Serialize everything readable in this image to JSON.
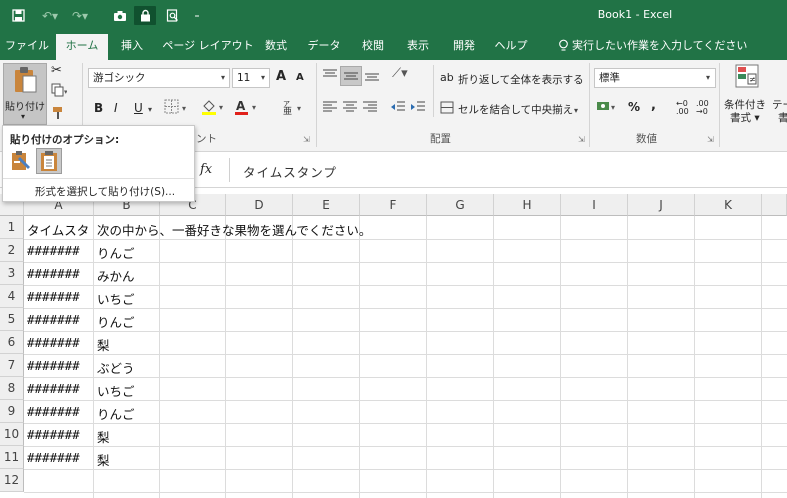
{
  "window": {
    "title": "Book1  -  Excel"
  },
  "tabs": [
    "ファイル",
    "ホーム",
    "挿入",
    "ページ レイアウト",
    "数式",
    "データ",
    "校閲",
    "表示",
    "開発",
    "ヘルプ"
  ],
  "tell_me": "実行したい作業を入力してください",
  "ribbon": {
    "paste_label": "貼り付け",
    "font_name": "游ゴシック",
    "font_size": "11",
    "grow_font": "A",
    "shrink_font": "A",
    "bold": "B",
    "italic": "I",
    "underline": "U",
    "wrap_text": "折り返して全体を表示する",
    "merge_center": "セルを結合して中央揃え",
    "number_format": "標準",
    "percent": "%",
    "comma": ",",
    "conditional_format_line1": "条件付き",
    "conditional_format_line2": "書式 ▾",
    "table_format_partial": "テー",
    "table_format_partial2": "書",
    "group_font_partial": "ント",
    "group_alignment": "配置",
    "group_number": "数値"
  },
  "paste_options": {
    "title": "貼り付けのオプション:",
    "paste_special": "形式を選択して貼り付け(S)..."
  },
  "formula_bar": {
    "fx": "fx",
    "value": "タイムスタンプ"
  },
  "columns": [
    "A",
    "B",
    "C",
    "D",
    "E",
    "F",
    "G",
    "H",
    "I",
    "J",
    "K"
  ],
  "rows": [
    {
      "num": "1",
      "a": "タイムスタ",
      "b": "次の中から、一番好きな果物を選んでください。"
    },
    {
      "num": "2",
      "a": "#######",
      "b": "りんご"
    },
    {
      "num": "3",
      "a": "#######",
      "b": "みかん"
    },
    {
      "num": "4",
      "a": "#######",
      "b": "いちご"
    },
    {
      "num": "5",
      "a": "#######",
      "b": "りんご"
    },
    {
      "num": "6",
      "a": "#######",
      "b": "梨"
    },
    {
      "num": "7",
      "a": "#######",
      "b": "ぶどう"
    },
    {
      "num": "8",
      "a": "#######",
      "b": "いちご"
    },
    {
      "num": "9",
      "a": "#######",
      "b": "りんご"
    },
    {
      "num": "10",
      "a": "#######",
      "b": "梨"
    },
    {
      "num": "11",
      "a": "#######",
      "b": "梨"
    },
    {
      "num": "12",
      "a": "",
      "b": ""
    }
  ],
  "colors": {
    "excel_green": "#217346",
    "ribbon_bg": "#f3f3f3"
  }
}
